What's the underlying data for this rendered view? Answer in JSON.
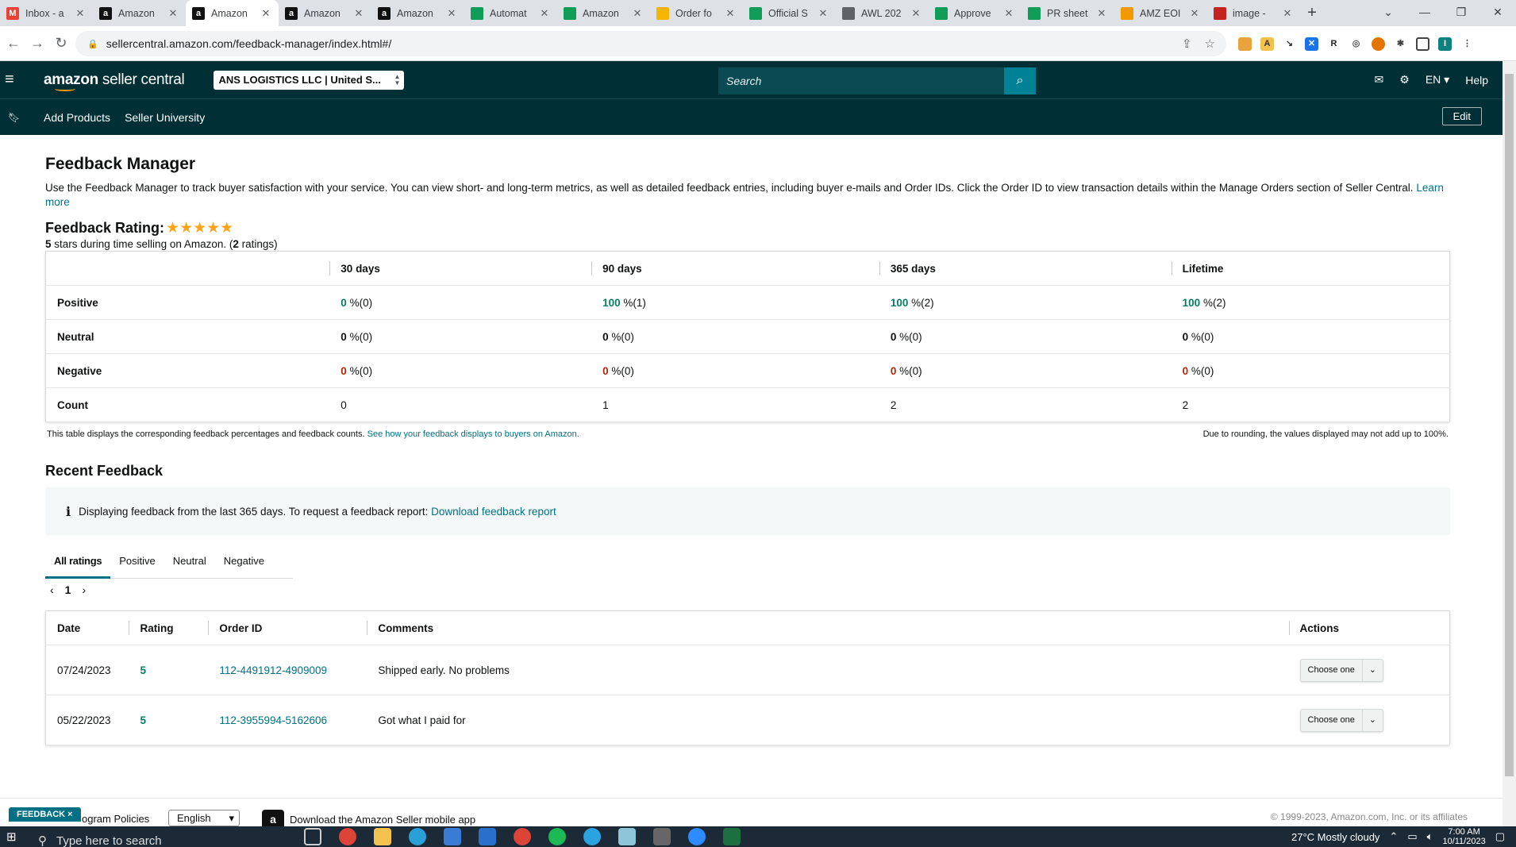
{
  "browser": {
    "tabs": [
      {
        "title": "Inbox - a",
        "fav": "gmail-icon",
        "color": "#ea4335"
      },
      {
        "title": "Amazon",
        "fav": "amazon-icon",
        "color": "#111111"
      },
      {
        "title": "Amazon",
        "fav": "amazon-icon",
        "color": "#111111",
        "active": true
      },
      {
        "title": "Amazon",
        "fav": "amazon-icon",
        "color": "#111111"
      },
      {
        "title": "Amazon",
        "fav": "amazon-icon",
        "color": "#111111"
      },
      {
        "title": "Automat",
        "fav": "sheets-icon",
        "color": "#0f9d58"
      },
      {
        "title": "Amazon",
        "fav": "sheets-icon",
        "color": "#0f9d58"
      },
      {
        "title": "Order fo",
        "fav": "drive-icon",
        "color": "#f4b400"
      },
      {
        "title": "Official S",
        "fav": "sheets-icon",
        "color": "#0f9d58"
      },
      {
        "title": "AWL 202",
        "fav": "globe-icon",
        "color": "#5f6368"
      },
      {
        "title": "Approve",
        "fav": "sheets-icon",
        "color": "#0f9d58"
      },
      {
        "title": "PR sheet",
        "fav": "sheets-icon",
        "color": "#0f9d58"
      },
      {
        "title": "AMZ EOI",
        "fav": "pen-icon",
        "color": "#f29900"
      },
      {
        "title": "image - ",
        "fav": "vivaldi-icon",
        "color": "#c5221f"
      }
    ],
    "url": "sellercentral.amazon.com/feedback-manager/index.html#/"
  },
  "header": {
    "logo_main": "amazon",
    "logo_sub": " seller central",
    "account": "ANS LOGISTICS LLC | United S...",
    "search_placeholder": "Search",
    "lang": "EN",
    "help": "Help",
    "nav_add_products": "Add Products",
    "nav_seller_university": "Seller University",
    "edit": "Edit"
  },
  "page": {
    "title": "Feedback Manager",
    "intro": "Use the Feedback Manager to track buyer satisfaction with your service. You can view short- and long-term metrics, as well as detailed feedback entries, including buyer e-mails and Order IDs. Click the Order ID to view transaction details within the Manage Orders section of Seller Central.",
    "learn_more": "Learn more",
    "rating_label": "Feedback Rating:",
    "rating_stars": 5,
    "summary_pre": "5",
    "summary_mid": " stars during time selling on Amazon. (",
    "summary_count": "2",
    "summary_post": " ratings)"
  },
  "metrics": {
    "columns": [
      "30 days",
      "90 days",
      "365 days",
      "Lifetime"
    ],
    "rows": [
      {
        "label": "Positive",
        "kind": "pos",
        "cells": [
          [
            "0",
            " %(0)"
          ],
          [
            "100",
            " %(1)"
          ],
          [
            "100",
            " %(2)"
          ],
          [
            "100",
            " %(2)"
          ]
        ]
      },
      {
        "label": "Neutral",
        "kind": "neu",
        "cells": [
          [
            "0",
            " %(0)"
          ],
          [
            "0",
            " %(0)"
          ],
          [
            "0",
            " %(0)"
          ],
          [
            "0",
            " %(0)"
          ]
        ]
      },
      {
        "label": "Negative",
        "kind": "neg",
        "cells": [
          [
            "0",
            " %(0)"
          ],
          [
            "0",
            " %(0)"
          ],
          [
            "0",
            " %(0)"
          ],
          [
            "0",
            " %(0)"
          ]
        ]
      },
      {
        "label": "Count",
        "kind": "count",
        "cells": [
          [
            "0",
            ""
          ],
          [
            "1",
            ""
          ],
          [
            "2",
            ""
          ],
          [
            "2",
            ""
          ]
        ]
      }
    ],
    "note_left": "This table displays the corresponding feedback percentages and feedback counts.",
    "note_link": "See how your feedback displays to buyers on Amazon.",
    "note_right": "Due to rounding, the values displayed may not add up to 100%."
  },
  "recent": {
    "title": "Recent Feedback",
    "info": "Displaying feedback from the last 365 days. To request a feedback report:",
    "info_link": "Download feedback report",
    "tabs": [
      "All ratings",
      "Positive",
      "Neutral",
      "Negative"
    ],
    "page": "1",
    "columns": [
      "Date",
      "Rating",
      "Order ID",
      "Comments",
      "Actions"
    ],
    "rows": [
      {
        "date": "07/24/2023",
        "rating": "5",
        "order": "112-4491912-4909009",
        "comment": "Shipped early. No problems",
        "action": "Choose one"
      },
      {
        "date": "05/22/2023",
        "rating": "5",
        "order": "112-3955994-5162606",
        "comment": "Got what I paid for",
        "action": "Choose one"
      }
    ]
  },
  "footer": {
    "feedback_tag": "FEEDBACK ×",
    "policies": "ogram Policies",
    "language": "English",
    "app": "Download the Amazon Seller mobile app",
    "copyright": "© 1999-2023, Amazon.com, Inc. or its affiliates"
  },
  "taskbar": {
    "search": "Type here to search",
    "weather": "27°C  Mostly cloudy",
    "time": "7:00 AM",
    "date": "10/11/2023"
  }
}
